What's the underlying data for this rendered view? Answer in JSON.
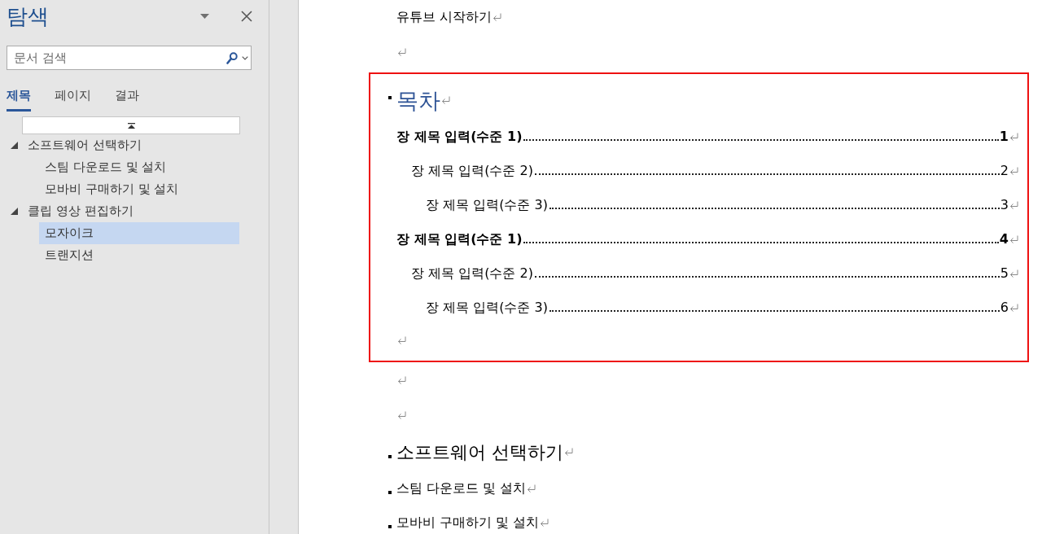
{
  "nav_pane": {
    "title": "탐색",
    "search": {
      "placeholder": "문서 검색"
    },
    "tabs": [
      {
        "label": "제목",
        "selected": true
      },
      {
        "label": "페이지",
        "selected": false
      },
      {
        "label": "결과",
        "selected": false
      }
    ],
    "headings": [
      {
        "label": "소프트웨어 선택하기",
        "expanded": true,
        "selected": false,
        "children": [
          {
            "label": "스팀 다운로드 및 설치",
            "selected": false
          },
          {
            "label": "모바비 구매하기 및 설치",
            "selected": false
          }
        ]
      },
      {
        "label": "클립 영상 편집하기",
        "expanded": true,
        "selected": false,
        "children": [
          {
            "label": "모자이크",
            "selected": true
          },
          {
            "label": "트랜지션",
            "selected": false
          }
        ]
      }
    ]
  },
  "document": {
    "paragraphs": [
      {
        "kind": "body",
        "text": "유튜브 시작하기"
      },
      {
        "kind": "empty"
      },
      {
        "kind": "toc",
        "title": "목차",
        "entries": [
          {
            "text": "장 제목 입력(수준 1)",
            "page": "1",
            "children": [
              {
                "text": "장 제목 입력(수준 2)",
                "page": "2",
                "children": [
                  {
                    "text": "장 제목 입력(수준 3)",
                    "page": "3"
                  }
                ]
              }
            ]
          },
          {
            "text": "장 제목 입력(수준 1)",
            "page": "4",
            "children": [
              {
                "text": "장 제목 입력(수준 2)",
                "page": "5",
                "children": [
                  {
                    "text": "장 제목 입력(수준 3)",
                    "page": "6"
                  }
                ]
              }
            ]
          }
        ]
      },
      {
        "kind": "empty"
      },
      {
        "kind": "empty"
      },
      {
        "kind": "heading1",
        "text": "소프트웨어 선택하기"
      },
      {
        "kind": "heading2",
        "text": "스팀 다운로드 및 설치"
      },
      {
        "kind": "heading2",
        "text": "모바비 구매하기 및 설치"
      }
    ]
  }
}
